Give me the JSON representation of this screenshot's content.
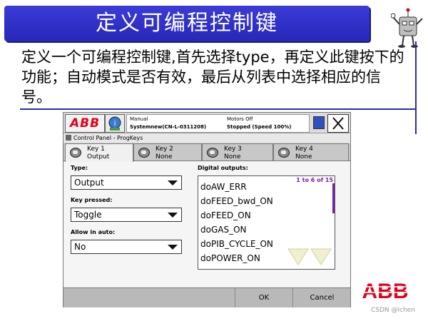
{
  "slide": {
    "title": "定义可编程控制键",
    "description": "定义一个可编程控制键,首先选择type，再定义此键按下的功能；自动模式是否有效，最后从列表中选择相应的信号。"
  },
  "flexpendant": {
    "menu_logo": "ABB",
    "status": {
      "mode": "Manual",
      "system": "Systemnew(CN-L-0311208)",
      "motors": "Motors Off",
      "state": "Stopped (Speed 100%)"
    },
    "window_title": "Control Panel - ProgKeys",
    "tabs": [
      {
        "label": "Key 1",
        "value": "Output"
      },
      {
        "label": "Key 2",
        "value": "None"
      },
      {
        "label": "Key 3",
        "value": "None"
      },
      {
        "label": "Key 4",
        "value": "None"
      }
    ],
    "type_label": "Type:",
    "type_value": "Output",
    "key_pressed_label": "Key pressed:",
    "key_pressed_value": "Toggle",
    "allow_auto_label": "Allow in auto:",
    "allow_auto_value": "No",
    "outputs_label": "Digital outputs:",
    "outputs_count": "1 to 6 of 15",
    "outputs": [
      "doAW_ERR",
      "doFEED_bwd_ON",
      "doFEED_ON",
      "doGAS_ON",
      "doPIB_CYCLE_ON",
      "doPOWER_ON"
    ],
    "ok_label": "OK",
    "cancel_label": "Cancel"
  },
  "logo_text": "ABB",
  "watermark": "CSDN @lchen",
  "colors": {
    "title_blue": "#2b2bc4",
    "abb_red": "#e2001a",
    "scroll_purple": "#7a1db0"
  }
}
